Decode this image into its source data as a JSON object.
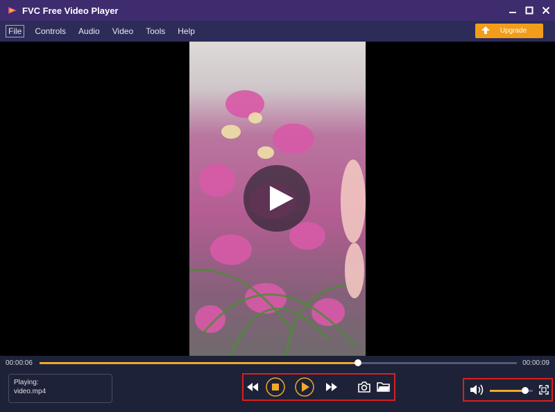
{
  "window": {
    "title": "FVC Free Video Player",
    "logo_icon": "play-triangle-icon",
    "controls": [
      "minimize-icon",
      "maximize-icon",
      "close-icon"
    ]
  },
  "menu": {
    "items": [
      {
        "label": "File"
      },
      {
        "label": "Controls"
      },
      {
        "label": "Audio"
      },
      {
        "label": "Video"
      },
      {
        "label": "Tools"
      },
      {
        "label": "Help"
      }
    ],
    "upgrade_label": "Upgrade",
    "upgrade_icon": "upload-arrow-icon",
    "upgrade_color": "#f29d1a"
  },
  "playback": {
    "current_time": "00:00:06",
    "total_time": "00:00:09",
    "progress_fraction": 0.667,
    "accent_color": "#f0a92a"
  },
  "now_playing": {
    "status_label": "Playing:",
    "file_name": "video.mp4"
  },
  "controls": {
    "buttons": [
      "rewind-icon",
      "stop-icon",
      "play-icon",
      "fast-forward-icon",
      "snapshot-camera-icon",
      "open-folder-icon"
    ]
  },
  "volume": {
    "level_fraction": 0.82,
    "icon": "volume-icon",
    "fullscreen_icon": "fullscreen-icon"
  }
}
